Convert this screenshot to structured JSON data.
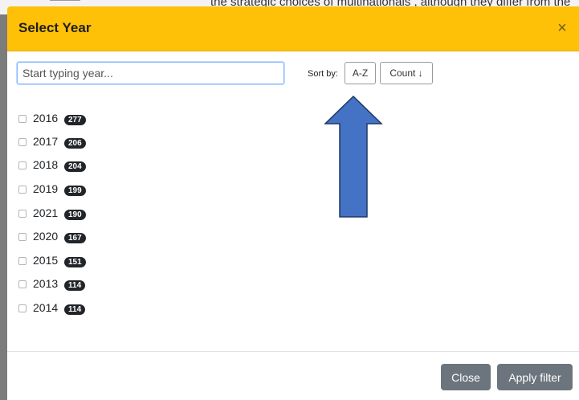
{
  "background": {
    "text": "the strategic choices of multinationals , although they differ from the"
  },
  "modal": {
    "title": "Select Year",
    "close_glyph": "×",
    "header_color": "#fec107"
  },
  "search": {
    "placeholder": "Start typing year...",
    "value": ""
  },
  "sort": {
    "label": "Sort by:",
    "options": [
      "A-Z",
      "Count ↓"
    ]
  },
  "years": [
    {
      "year": "2016",
      "count": "277"
    },
    {
      "year": "2017",
      "count": "206"
    },
    {
      "year": "2018",
      "count": "204"
    },
    {
      "year": "2019",
      "count": "199"
    },
    {
      "year": "2021",
      "count": "190"
    },
    {
      "year": "2020",
      "count": "167"
    },
    {
      "year": "2015",
      "count": "151"
    },
    {
      "year": "2013",
      "count": "114"
    },
    {
      "year": "2014",
      "count": "114"
    }
  ],
  "footer": {
    "close_label": "Close",
    "apply_label": "Apply filter"
  },
  "annotation": {
    "icon": "up-arrow-icon",
    "color": "#4472c4"
  }
}
